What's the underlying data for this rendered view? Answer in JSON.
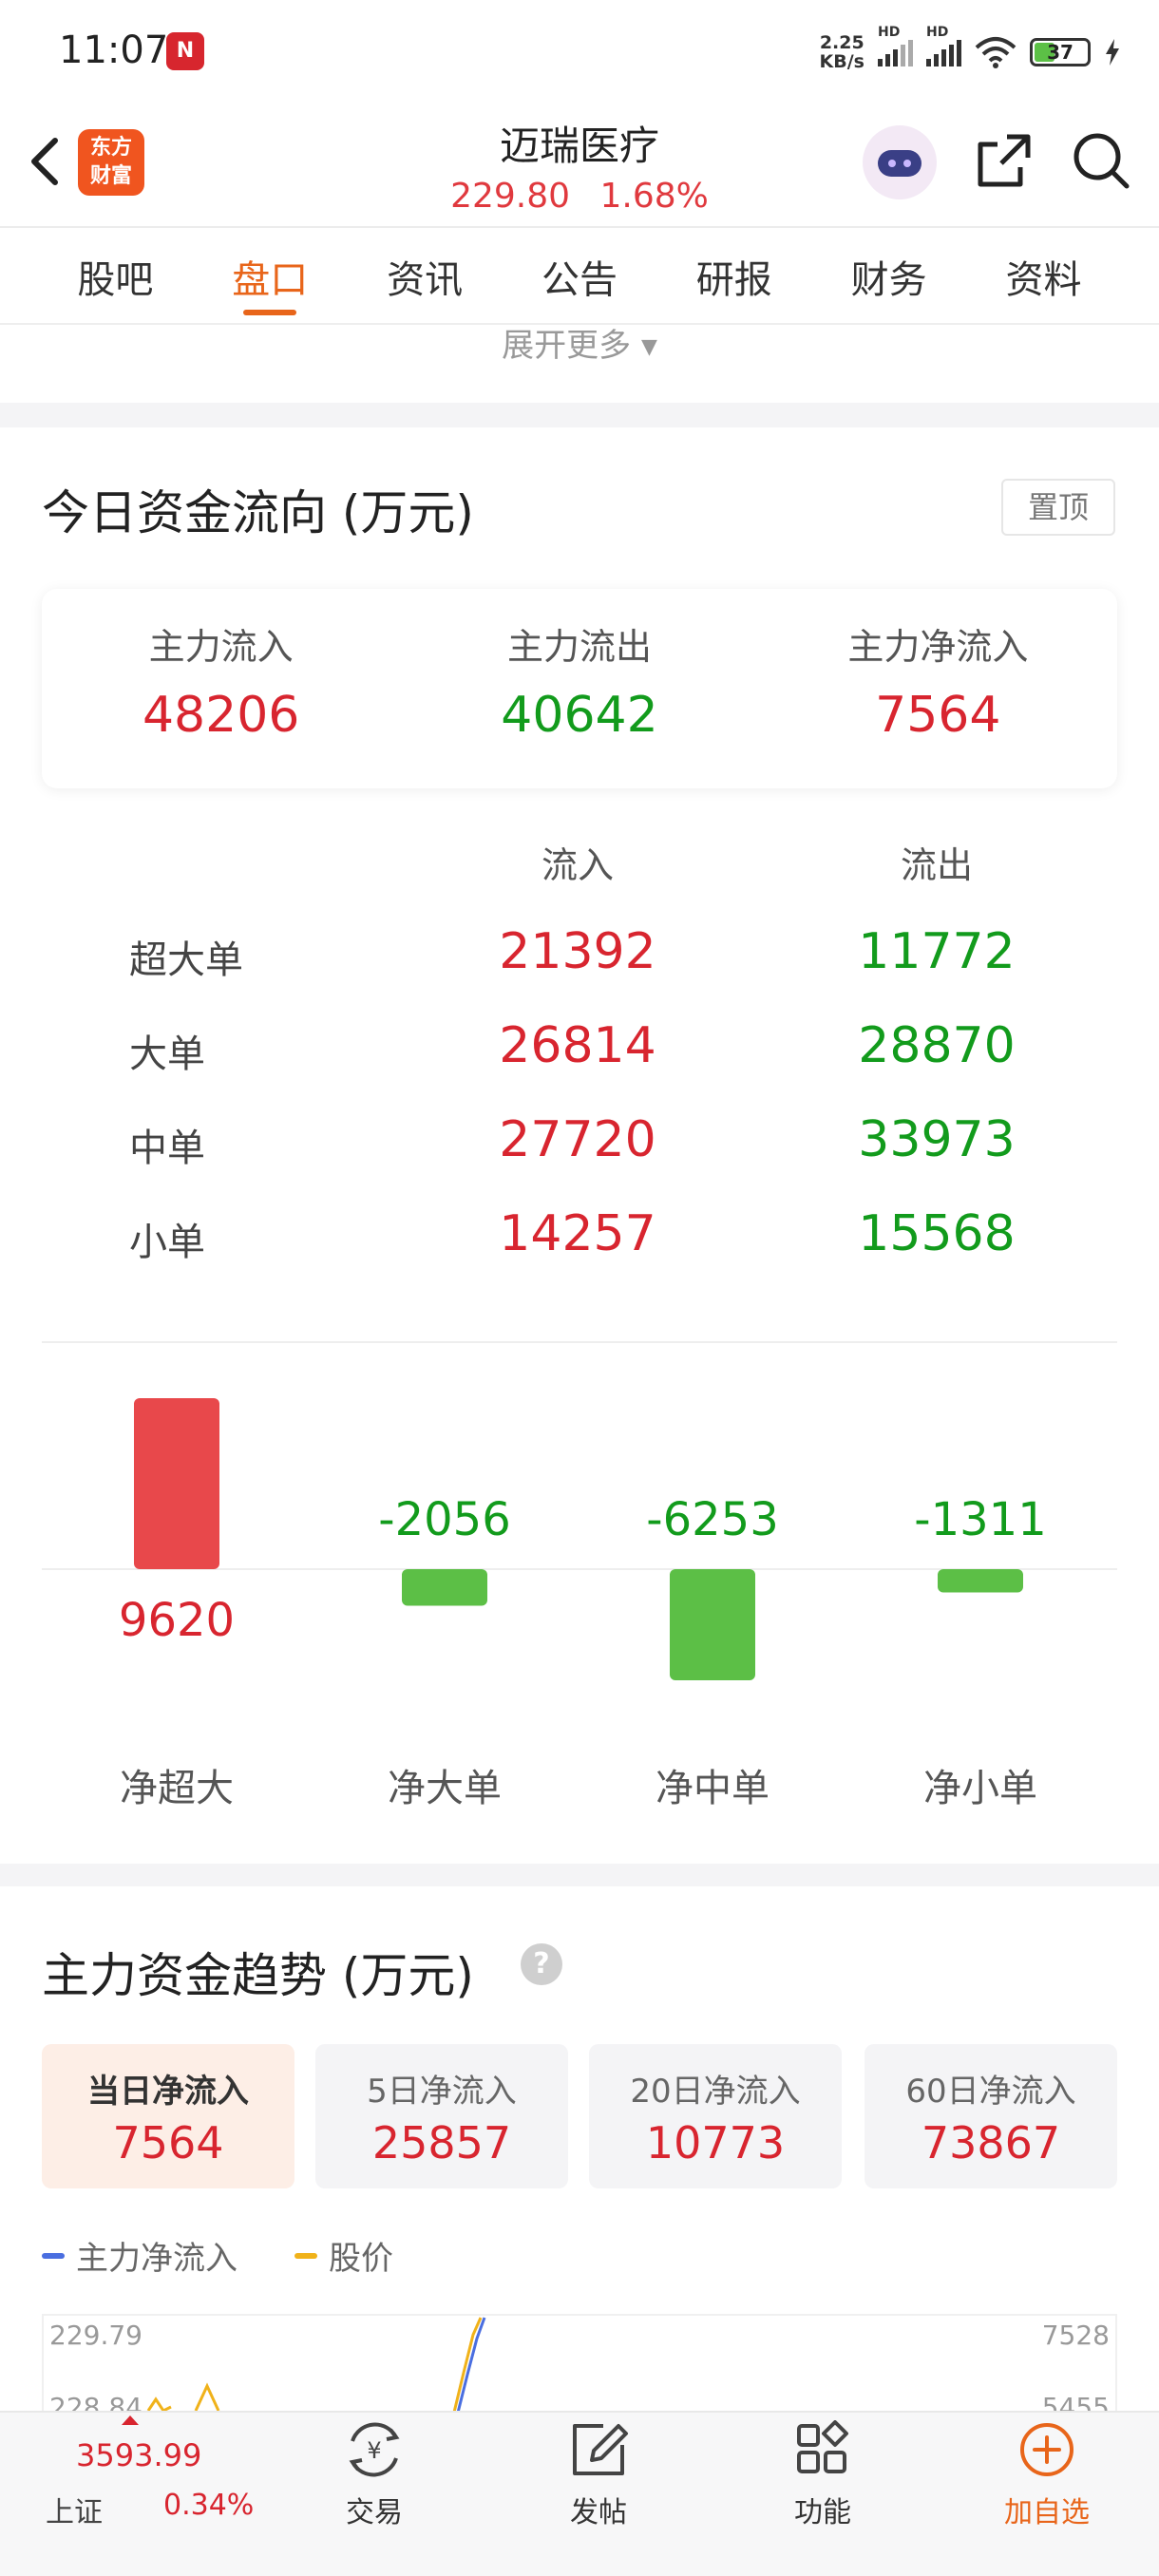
{
  "status_bar": {
    "time": "11:07",
    "net_speed_value": "2.25",
    "net_speed_unit": "KB/s",
    "hd1": "HD",
    "hd2": "HD",
    "battery": "37"
  },
  "header": {
    "logo_line1": "东方",
    "logo_line2": "财富",
    "stock_name": "迈瑞医疗",
    "price": "229.80",
    "change_pct": "1.68%"
  },
  "tabs": [
    {
      "label": "股吧",
      "active": false
    },
    {
      "label": "盘口",
      "active": true
    },
    {
      "label": "资讯",
      "active": false
    },
    {
      "label": "公告",
      "active": false
    },
    {
      "label": "研报",
      "active": false
    },
    {
      "label": "财务",
      "active": false
    },
    {
      "label": "资料",
      "active": false
    }
  ],
  "expand_more": "展开更多",
  "fund_flow": {
    "title": "今日资金流向 (万元)",
    "pin_label": "置顶",
    "summary": [
      {
        "label": "主力流入",
        "value": "48206",
        "color": "#d8252f"
      },
      {
        "label": "主力流出",
        "value": "40642",
        "color": "#129b1c"
      },
      {
        "label": "主力净流入",
        "value": "7564",
        "color": "#d8252f"
      }
    ],
    "col_in": "流入",
    "col_out": "流出",
    "rows": [
      {
        "label": "超大单",
        "in": "21392",
        "out": "11772"
      },
      {
        "label": "大单",
        "in": "26814",
        "out": "28870"
      },
      {
        "label": "中单",
        "in": "27720",
        "out": "33973"
      },
      {
        "label": "小单",
        "in": "14257",
        "out": "15568"
      }
    ]
  },
  "chart_data": {
    "type": "bar",
    "categories": [
      "净超大",
      "净大单",
      "净中单",
      "净小单"
    ],
    "values": [
      9620,
      -2056,
      -6253,
      -1311
    ],
    "positive_color": "#e8484b",
    "negative_color": "#5cbf46"
  },
  "trend": {
    "title": "主力资金趋势 (万元)",
    "periods": [
      {
        "label": "当日净流入",
        "value": "7564",
        "active": true
      },
      {
        "label": "5日净流入",
        "value": "25857",
        "active": false
      },
      {
        "label": "20日净流入",
        "value": "10773",
        "active": false
      },
      {
        "label": "60日净流入",
        "value": "73867",
        "active": false
      }
    ],
    "legend": [
      {
        "label": "主力净流入",
        "color": "#4a6ee0"
      },
      {
        "label": "股价",
        "color": "#f0b21a"
      }
    ],
    "y_left_top": "229.79",
    "y_left_second": "228.84",
    "y_right_top": "7528",
    "y_right_second": "5455"
  },
  "bottom_nav": {
    "index_value": "3593.99",
    "index_name": "上证",
    "index_pct": "0.34%",
    "items": [
      {
        "label": "交易",
        "icon": "yuan-exchange-icon"
      },
      {
        "label": "发帖",
        "icon": "edit-post-icon"
      },
      {
        "label": "功能",
        "icon": "grid-functions-icon"
      },
      {
        "label": "加自选",
        "icon": "add-favorite-icon"
      }
    ]
  }
}
